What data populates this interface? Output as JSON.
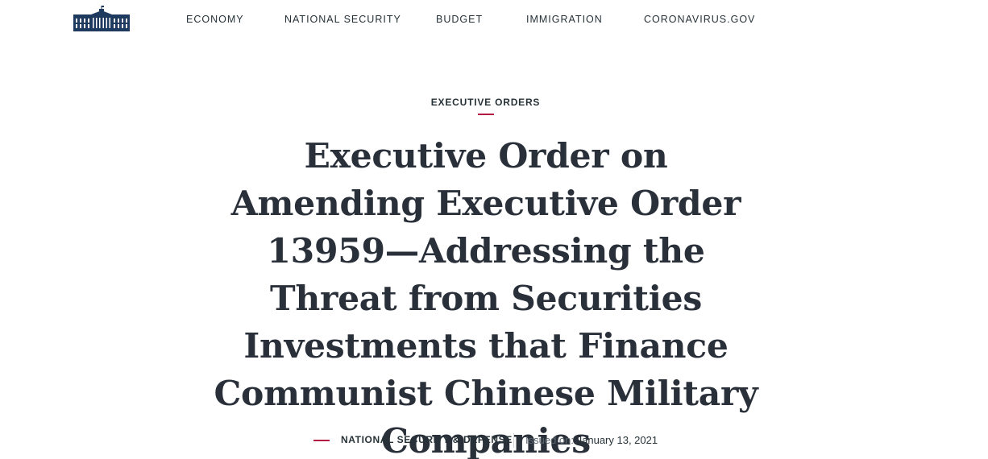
{
  "header": {
    "logo_icon": "white-house-logo-icon",
    "nav": [
      {
        "label": "ECONOMY"
      },
      {
        "label": "NATIONAL SECURITY"
      },
      {
        "label": "BUDGET"
      },
      {
        "label": "IMMIGRATION"
      },
      {
        "label": "CORONAVIRUS.GOV"
      }
    ]
  },
  "article": {
    "category": "EXECUTIVE ORDERS",
    "title": "Executive Order on Amending Executive Order 13959—Addressing the Threat from Securities Investments that Finance Communist Chinese Military Companies",
    "topic": "NATIONAL SECURITY & DEFENSE",
    "issued_label": "Issued on:",
    "issued_date": "January 13, 2021"
  },
  "colors": {
    "text": "#2a3039",
    "accent_red": "#b31942",
    "logo_navy": "#1f3a5f"
  }
}
